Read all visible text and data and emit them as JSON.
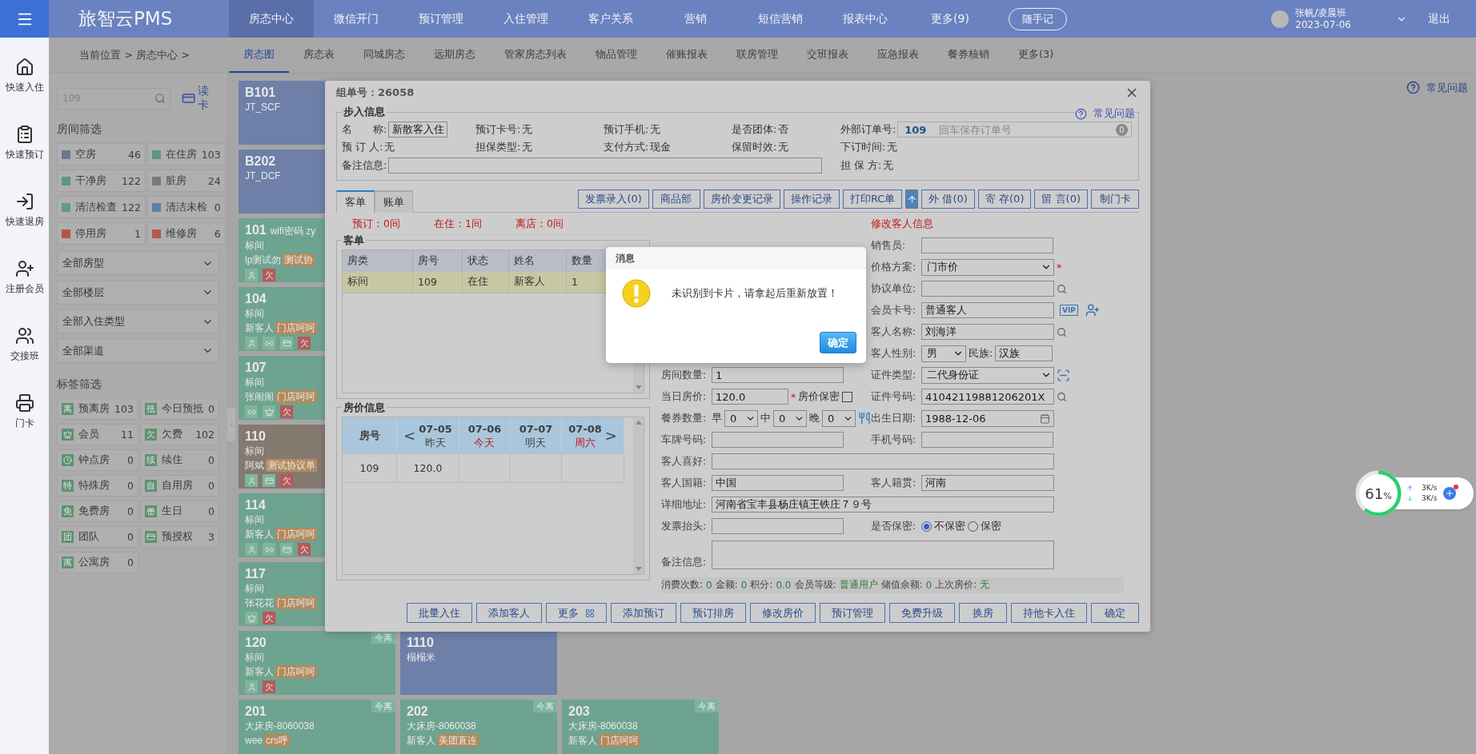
{
  "topbar": {
    "logo": "旅智云PMS",
    "nav": [
      {
        "label": "房态中心",
        "selected": true
      },
      {
        "label": "微信开门",
        "selected": false
      },
      {
        "label": "预订管理",
        "selected": false
      },
      {
        "label": "入住管理",
        "selected": false
      },
      {
        "label": "客户关系",
        "selected": false
      },
      {
        "label": "营销",
        "selected": false
      },
      {
        "label": "短信营销",
        "selected": false
      },
      {
        "label": "报表中心",
        "selected": false
      },
      {
        "label": "更多(9)",
        "selected": false
      }
    ],
    "note_button": "随手记",
    "user": {
      "name": "张帆/凌晨班",
      "date": "2023-07-06"
    },
    "logout": "退出"
  },
  "subnav": {
    "breadcrumb": "当前位置 > 房态中心 >",
    "tabs": [
      {
        "label": "房态图",
        "selected": true
      },
      {
        "label": "房态表",
        "selected": false
      },
      {
        "label": "同城房态",
        "selected": false
      },
      {
        "label": "远期房态",
        "selected": false
      },
      {
        "label": "管家房态列表",
        "selected": false
      },
      {
        "label": "物品管理",
        "selected": false
      },
      {
        "label": "催账报表",
        "selected": false
      },
      {
        "label": "联房管理",
        "selected": false
      },
      {
        "label": "交班报表",
        "selected": false
      },
      {
        "label": "应急报表",
        "selected": false
      },
      {
        "label": "餐券核销",
        "selected": false
      },
      {
        "label": "更多(3)",
        "selected": false
      }
    ],
    "help": "常见问题"
  },
  "sidebar": {
    "items": [
      {
        "kind": "checkin",
        "label": "快速入住"
      },
      {
        "kind": "booking",
        "label": "快速预订"
      },
      {
        "kind": "checkout",
        "label": "快速退房"
      },
      {
        "kind": "member",
        "label": "注册会员"
      },
      {
        "kind": "shift",
        "label": "交接班"
      },
      {
        "kind": "card",
        "label": "门卡"
      }
    ]
  },
  "filter": {
    "search": {
      "placeholder": "109"
    },
    "read_card": "读卡",
    "room_title": "房间筛选",
    "statuses": [
      {
        "label": "空房",
        "count": "46",
        "color": "#6c7691"
      },
      {
        "label": "在住房",
        "count": "103",
        "color": "#5d9680"
      },
      {
        "label": "干净房",
        "count": "122",
        "color": "#5d9688"
      },
      {
        "label": "脏房",
        "count": "24",
        "color": "#7a7a7a"
      },
      {
        "label": "清洁检查",
        "count": "122",
        "color": "#609a8a"
      },
      {
        "label": "清洁未检",
        "count": "0",
        "color": "#5a80a8"
      },
      {
        "label": "停用房",
        "count": "1",
        "color": "#b0564c"
      },
      {
        "label": "维修房",
        "count": "6",
        "color": "#b05a50"
      }
    ],
    "selects": [
      "全部房型",
      "全部楼层",
      "全部入住类型",
      "全部渠道"
    ],
    "tag_title": "标签筛选",
    "tags": [
      {
        "kind": "text",
        "badge": "离",
        "label": "预离房",
        "count": "103"
      },
      {
        "kind": "text",
        "badge": "抵",
        "label": "今日预抵",
        "count": "0"
      },
      {
        "kind": "vip",
        "label": "会员",
        "count": "11"
      },
      {
        "kind": "text",
        "badge": "欠",
        "label": "欠费",
        "count": "102"
      },
      {
        "kind": "clock",
        "label": "钟点房",
        "count": "0"
      },
      {
        "kind": "text",
        "badge": "续",
        "label": "续住",
        "count": "0"
      },
      {
        "kind": "text",
        "badge": "特",
        "label": "特殊房",
        "count": "0"
      },
      {
        "kind": "text",
        "badge": "自",
        "label": "自用房",
        "count": "0"
      },
      {
        "kind": "text",
        "badge": "免",
        "label": "免费房",
        "count": "0"
      },
      {
        "kind": "gift",
        "label": "生日",
        "count": "0"
      },
      {
        "kind": "text",
        "badge": "团",
        "label": "团队",
        "count": "0"
      },
      {
        "kind": "card",
        "label": "预授权",
        "count": "3"
      },
      {
        "kind": "text",
        "badge": "寓",
        "label": "公寓房",
        "count": "0"
      }
    ]
  },
  "rooms": {
    "rows": [
      [
        {
          "number": "B101",
          "type": "JT_SCF",
          "color": "#6e80a8"
        }
      ],
      [
        {
          "number": "B202",
          "type": "JT_DCF",
          "color": "#6e80a8"
        }
      ],
      [
        {
          "number": "101",
          "note": "wifi密码 zy",
          "type": "标间",
          "guest": "lp测试勿",
          "tag": "测试协",
          "icons": [
            {
              "kind": "person"
            }
          ],
          "debt": "欠",
          "color": "#6ea390"
        }
      ],
      [
        {
          "number": "104",
          "type": "标间",
          "guest": "新客人",
          "tag": "门店呵呵",
          "icons": [
            {
              "kind": "person"
            },
            {
              "kind": "link"
            },
            {
              "kind": "card"
            }
          ],
          "debt": "欠",
          "color": "#6ea390"
        }
      ],
      [
        {
          "number": "107",
          "type": "标间",
          "guest": "张闹闹",
          "tag": "门店呵呵",
          "icons": [
            {
              "kind": "link"
            },
            {
              "kind": "vip"
            }
          ],
          "debt": "欠",
          "color": "#6ea390"
        }
      ],
      [
        {
          "number": "110",
          "type": "标间",
          "guest": "阿斌",
          "tag": "测试协议单",
          "icons": [
            {
              "kind": "person"
            },
            {
              "kind": "card"
            }
          ],
          "debt": "欠",
          "color": "#857a70"
        }
      ],
      [
        {
          "number": "114",
          "type": "标间",
          "guest": "新客人",
          "tag": "门店呵呵",
          "icons": [
            {
              "kind": "person"
            },
            {
              "kind": "link"
            },
            {
              "kind": "card"
            }
          ],
          "debt": "欠",
          "color": "#6ea390"
        }
      ],
      [
        {
          "number": "117",
          "type": "标间",
          "guest": "张花花",
          "tag": "门店呵呵",
          "icons": [
            {
              "kind": "vip"
            }
          ],
          "debt": "欠",
          "color": "#6ea390"
        }
      ],
      [
        {
          "number": "120",
          "type": "标间",
          "guest": "新客人",
          "tag": "门店呵呵",
          "icons": [
            {
              "kind": "person"
            }
          ],
          "debt": "欠",
          "leaving": "今离",
          "color": "#6ea390"
        },
        {
          "number": "1110",
          "type": "榻榻米",
          "color": "#6e80a8"
        }
      ],
      [
        {
          "number": "201",
          "type": "大床房-8060038",
          "guest": "wee",
          "tag": "crs呼",
          "leaving": "今离",
          "color": "#6ea390"
        },
        {
          "number": "202",
          "type": "大床房-8060038",
          "guest": "新客人",
          "tag": "美团直连",
          "leaving": "今离",
          "color": "#6ea390"
        },
        {
          "number": "203",
          "type": "大床房-8060038",
          "guest": "新客人",
          "tag": "门店呵呵",
          "leaving": "今离",
          "color": "#6ea390"
        }
      ]
    ]
  },
  "dialog": {
    "title": "组单号：26058",
    "walkin": {
      "legend": "步入信息",
      "help": "常见问题",
      "items": [
        {
          "kind": "input",
          "label": "名　　称:",
          "value": "新散客入住"
        },
        {
          "kind": "info",
          "label": "预订卡号:",
          "value": "无"
        },
        {
          "kind": "info",
          "label": "预订手机:",
          "value": "无"
        },
        {
          "kind": "info",
          "label": "是否团体:",
          "value": "否"
        },
        {
          "kind": "order",
          "label": "外部订单号:",
          "value": "109",
          "placeholder": "回车保存订单号",
          "count": "0"
        },
        {
          "kind": "info",
          "label": "预 订 人:",
          "value": "无"
        },
        {
          "kind": "info",
          "label": "担保类型:",
          "value": "无"
        },
        {
          "kind": "info",
          "label": "支付方式:",
          "value": "现金"
        },
        {
          "kind": "info",
          "label": "保留时效:",
          "value": "无"
        },
        {
          "kind": "info",
          "label": "下订时间:",
          "value": "无"
        },
        {
          "kind": "remark",
          "label": "备注信息:"
        },
        {
          "kind": "info",
          "label": "担 保 方:",
          "value": "无"
        }
      ]
    },
    "tabs": [
      {
        "label": "客单",
        "selected": true
      },
      {
        "label": "账单",
        "selected": false
      }
    ],
    "actions": [
      {
        "kind": "text",
        "label": "发票录入(0)"
      },
      {
        "kind": "text",
        "label": "商品部"
      },
      {
        "kind": "text",
        "label": "房价变更记录"
      },
      {
        "kind": "text",
        "label": "操作记录"
      },
      {
        "kind": "text",
        "label": "打印RC单"
      },
      {
        "kind": "upload"
      },
      {
        "kind": "text",
        "label": "外 借(0)"
      },
      {
        "kind": "text",
        "label": "寄 存(0)"
      },
      {
        "kind": "text",
        "label": "留 言(0)"
      },
      {
        "kind": "text",
        "label": "制门卡"
      }
    ],
    "counts": [
      "预订：0间",
      "在住：1间",
      "离店：0间"
    ],
    "edit_title": "修改客人信息",
    "orders": {
      "legend": "客单",
      "columns": [
        "房类",
        "房号",
        "状态",
        "姓名",
        "数量"
      ],
      "rows": [
        {
          "cells": [
            "标间",
            "109",
            "在住",
            "新客人",
            "1"
          ],
          "selected": true
        }
      ]
    },
    "prices": {
      "legend": "房价信息",
      "room_column": "房号",
      "prev": "<",
      "next": ">",
      "dates": [
        {
          "date": "07-05",
          "day": "昨天",
          "highlighted": false
        },
        {
          "date": "07-06",
          "day": "今天",
          "highlighted": true
        },
        {
          "date": "07-07",
          "day": "明天",
          "highlighted": false
        },
        {
          "date": "07-08",
          "day": "周六",
          "highlighted": true
        }
      ],
      "rows": [
        {
          "room": "109",
          "prices": [
            "120.0"
          ]
        }
      ]
    },
    "middle": [
      {
        "kind": "input",
        "label": "房间数量:",
        "value": "1"
      },
      {
        "kind": "price",
        "label": "当日房价:",
        "value": "120.0",
        "required": "*",
        "secret": {
          "label": "房价保密",
          "checked": false
        }
      },
      {
        "kind": "meals",
        "label": "餐券数量:",
        "meals": [
          {
            "label": "早",
            "value": "0"
          },
          {
            "label": "中",
            "value": "0"
          },
          {
            "label": "晚",
            "value": "0"
          }
        ]
      },
      {
        "kind": "input",
        "label": "车牌号码:"
      }
    ],
    "right": [
      {
        "kind": "input",
        "label": "销售员:"
      },
      {
        "kind": "select",
        "label": "价格方案:",
        "value": "门市价",
        "required": "*"
      },
      {
        "kind": "search",
        "label": "协议单位:"
      },
      {
        "kind": "member",
        "label": "会员卡号:",
        "value": "普通客人",
        "badge": "VIP"
      },
      {
        "kind": "search",
        "label": "客人名称:",
        "value": "刘海洋"
      },
      {
        "kind": "gender",
        "label": "客人性别:",
        "value": "男",
        "extra": {
          "label": "民族:",
          "value": "汉族"
        }
      },
      {
        "kind": "idtype",
        "label": "证件类型:",
        "value": "二代身份证"
      },
      {
        "kind": "search",
        "label": "证件号码:",
        "value": "41042119881206201X"
      },
      {
        "kind": "date",
        "label": "出生日期:",
        "value": "1988-12-06"
      },
      {
        "kind": "input",
        "label": "手机号码:"
      }
    ],
    "wide": [
      {
        "kind": "wide",
        "label": "客人喜好:"
      },
      {
        "kind": "pair",
        "left": {
          "label": "客人国籍:",
          "value": "中国"
        },
        "right": {
          "label": "客人籍贯:",
          "value": "河南"
        }
      },
      {
        "kind": "wide",
        "label": "详细地址:",
        "value": "河南省宝丰县杨庄镇王铁庄７９号"
      },
      {
        "kind": "invoice",
        "label": "发票抬头:",
        "secret": {
          "label": "是否保密:",
          "options": [
            {
              "label": "不保密",
              "selected": true
            },
            {
              "label": "保密",
              "selected": false
            }
          ]
        }
      },
      {
        "kind": "textarea",
        "label": "备注信息:"
      }
    ],
    "stats": [
      {
        "label": "消费次数:",
        "value": "0"
      },
      {
        "label": "金额:",
        "value": "0"
      },
      {
        "label": "积分:",
        "value": "0.0"
      },
      {
        "label": "会员等级:",
        "value": "普通用户"
      },
      {
        "label": "储值余额:",
        "value": "0"
      },
      {
        "label": "上次房价:",
        "value": "无"
      }
    ],
    "buttons": [
      {
        "kind": "text",
        "label": "批量入住"
      },
      {
        "kind": "text",
        "label": "添加客人"
      },
      {
        "kind": "grid",
        "label": "更多"
      },
      {
        "kind": "text",
        "label": "添加预订"
      },
      {
        "kind": "text",
        "label": "预订排房"
      },
      {
        "kind": "text",
        "label": "修改房价"
      },
      {
        "kind": "text",
        "label": "预订管理"
      },
      {
        "kind": "text",
        "label": "免费升级"
      },
      {
        "kind": "text",
        "label": "换房"
      },
      {
        "kind": "text",
        "label": "持他卡入住"
      },
      {
        "kind": "text",
        "label": "确定"
      }
    ]
  },
  "message": {
    "title": "消息",
    "text": "未识别到卡片，请拿起后重新放置！",
    "button": "确定"
  },
  "widget": {
    "percent": "61",
    "unit": "%",
    "level": 0.61,
    "upload": "3K/s",
    "download": "3K/s"
  }
}
